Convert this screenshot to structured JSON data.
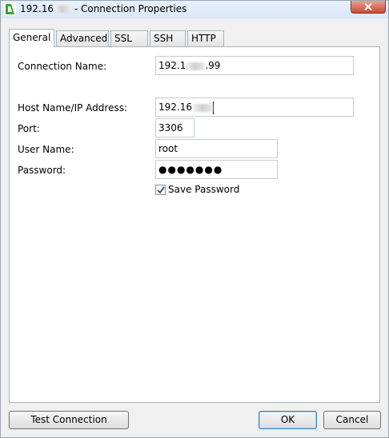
{
  "window": {
    "title": "192.168.1.99 - Connection Properties",
    "title_display_prefix": "192.16",
    "title_display_suffix": "- Connection Properties"
  },
  "tabs": [
    {
      "label": "General",
      "active": true
    },
    {
      "label": "Advanced",
      "active": false
    },
    {
      "label": "SSL",
      "active": false
    },
    {
      "label": "SSH",
      "active": false
    },
    {
      "label": "HTTP",
      "active": false
    }
  ],
  "form": {
    "connection_name": {
      "label": "Connection Name:",
      "value_prefix": "192.1",
      "value_suffix": ".99"
    },
    "host": {
      "label": "Host Name/IP Address:",
      "value_prefix": "192.16"
    },
    "port": {
      "label": "Port:",
      "value": "3306"
    },
    "user": {
      "label": "User Name:",
      "value": "root"
    },
    "password": {
      "label": "Password:",
      "value": "●●●●●●●"
    },
    "save_password": {
      "label": "Save Password",
      "checked": true
    }
  },
  "buttons": {
    "test_connection": "Test Connection",
    "ok": "OK",
    "cancel": "Cancel"
  },
  "colors": {
    "app_icon": "#3aa335",
    "close_button": "#c74a33",
    "default_button_border": "#3c7fb1"
  }
}
